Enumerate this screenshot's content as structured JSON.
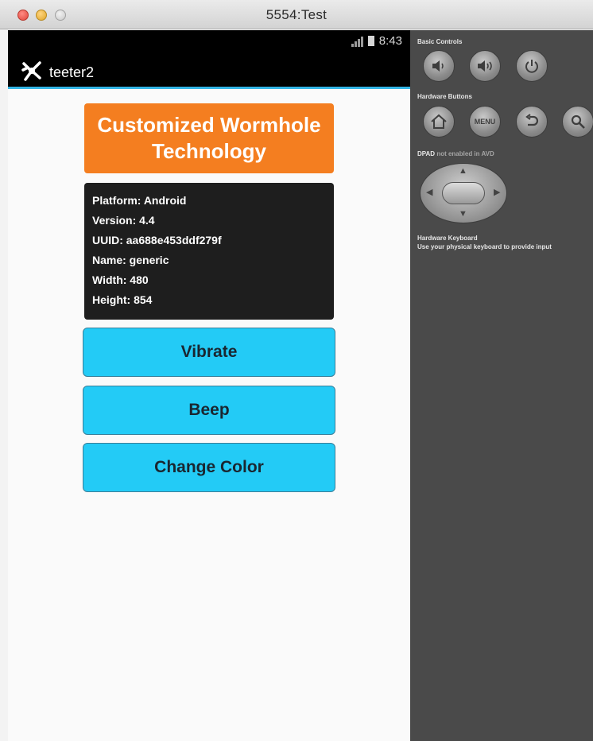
{
  "window": {
    "title": "5554:Test"
  },
  "device": {
    "status_bar": {
      "time": "8:43"
    },
    "action_bar": {
      "app_title": "teeter2"
    },
    "header": {
      "text": "Customized Wormhole Technology"
    },
    "info": [
      "Platform: Android",
      "Version: 4.4",
      "UUID: aa688e453ddf279f",
      "Name: generic",
      "Width: 480",
      "Height: 854"
    ],
    "buttons": {
      "vibrate": "Vibrate",
      "beep": "Beep",
      "change_color": "Change Color"
    }
  },
  "controls": {
    "basic_controls_label": "Basic Controls",
    "hardware_buttons_label": "Hardware Buttons",
    "dpad_label": "DPAD",
    "dpad_note": "not enabled in AVD",
    "keyboard_label": "Hardware Keyboard",
    "keyboard_note": "Use your physical keyboard to provide input",
    "menu_button": "MENU"
  },
  "colors": {
    "header_bg": "#f47e20",
    "info_bg": "#1e1e1e",
    "button_bg": "#23cbf6",
    "actionbar_accent": "#33b5e5",
    "controls_bg": "#4a4a4a"
  }
}
